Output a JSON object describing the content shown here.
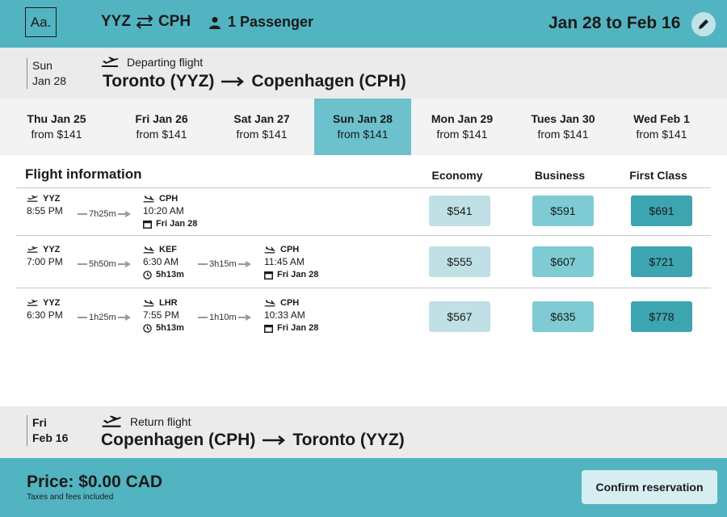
{
  "header": {
    "logo_text": "Aa.",
    "origin": "YYZ",
    "destination": "CPH",
    "passengers": "1 Passenger",
    "date_range": "Jan 28 to Feb 16"
  },
  "departing": {
    "weekday": "Sun",
    "date": "Jan 28",
    "label": "Departing flight",
    "from": "Toronto (YYZ)",
    "to": "Copenhagen (CPH)"
  },
  "day_tabs": [
    {
      "day": "Thu Jan 25",
      "price": "from $141"
    },
    {
      "day": "Fri Jan 26",
      "price": "from $141"
    },
    {
      "day": "Sat Jan 27",
      "price": "from $141"
    },
    {
      "day": "Sun Jan 28",
      "price": "from $141"
    },
    {
      "day": "Mon Jan 29",
      "price": "from $141"
    },
    {
      "day": "Tues Jan 30",
      "price": "from $141"
    },
    {
      "day": "Wed Feb 1",
      "price": "from $141"
    }
  ],
  "table": {
    "title": "Flight information",
    "economy": "Economy",
    "business": "Business",
    "first": "First Class"
  },
  "flights": [
    {
      "dep_code": "YYZ",
      "dep_time": "8:55 PM",
      "leg1_dur": "7h25m",
      "s1_code": "CPH",
      "s1_time": "10:20 AM",
      "s1_sub": "Fri Jan 28",
      "economy": "$541",
      "business": "$591",
      "first": "$691"
    },
    {
      "dep_code": "YYZ",
      "dep_time": "7:00 PM",
      "leg1_dur": "5h50m",
      "s1_code": "KEF",
      "s1_time": "6:30 AM",
      "s1_sub": "5h13m",
      "leg2_dur": "3h15m",
      "s2_code": "CPH",
      "s2_time": "11:45 AM",
      "s2_sub": "Fri Jan 28",
      "economy": "$555",
      "business": "$607",
      "first": "$721"
    },
    {
      "dep_code": "YYZ",
      "dep_time": "6:30 PM",
      "leg1_dur": "1h25m",
      "s1_code": "LHR",
      "s1_time": "7:55 PM",
      "s1_sub": "5h13m",
      "leg2_dur": "1h10m",
      "s2_code": "CPH",
      "s2_time": "10:33 AM",
      "s2_sub": "Fri Jan 28",
      "economy": "$567",
      "business": "$635",
      "first": "$778"
    }
  ],
  "returning": {
    "weekday": "Fri",
    "date": "Feb 16",
    "label": "Return flight",
    "from": "Copenhagen (CPH)",
    "to": "Toronto (YYZ)"
  },
  "footer": {
    "price": "Price: $0.00 CAD",
    "tax_note": "Taxes and fees included",
    "confirm": "Confirm reservation"
  },
  "colors": {
    "accent": "#53b4c1",
    "active_tab": "#6cc1cc",
    "economy": "#bfe0e4",
    "business": "#7ecbd4",
    "first": "#3da5b0"
  },
  "icons": {
    "swap": "swap-arrows-icon",
    "person": "person-icon",
    "edit": "pencil-icon",
    "takeoff": "takeoff-icon",
    "landing": "landing-icon",
    "calendar": "calendar-icon",
    "clock": "clock-icon"
  }
}
